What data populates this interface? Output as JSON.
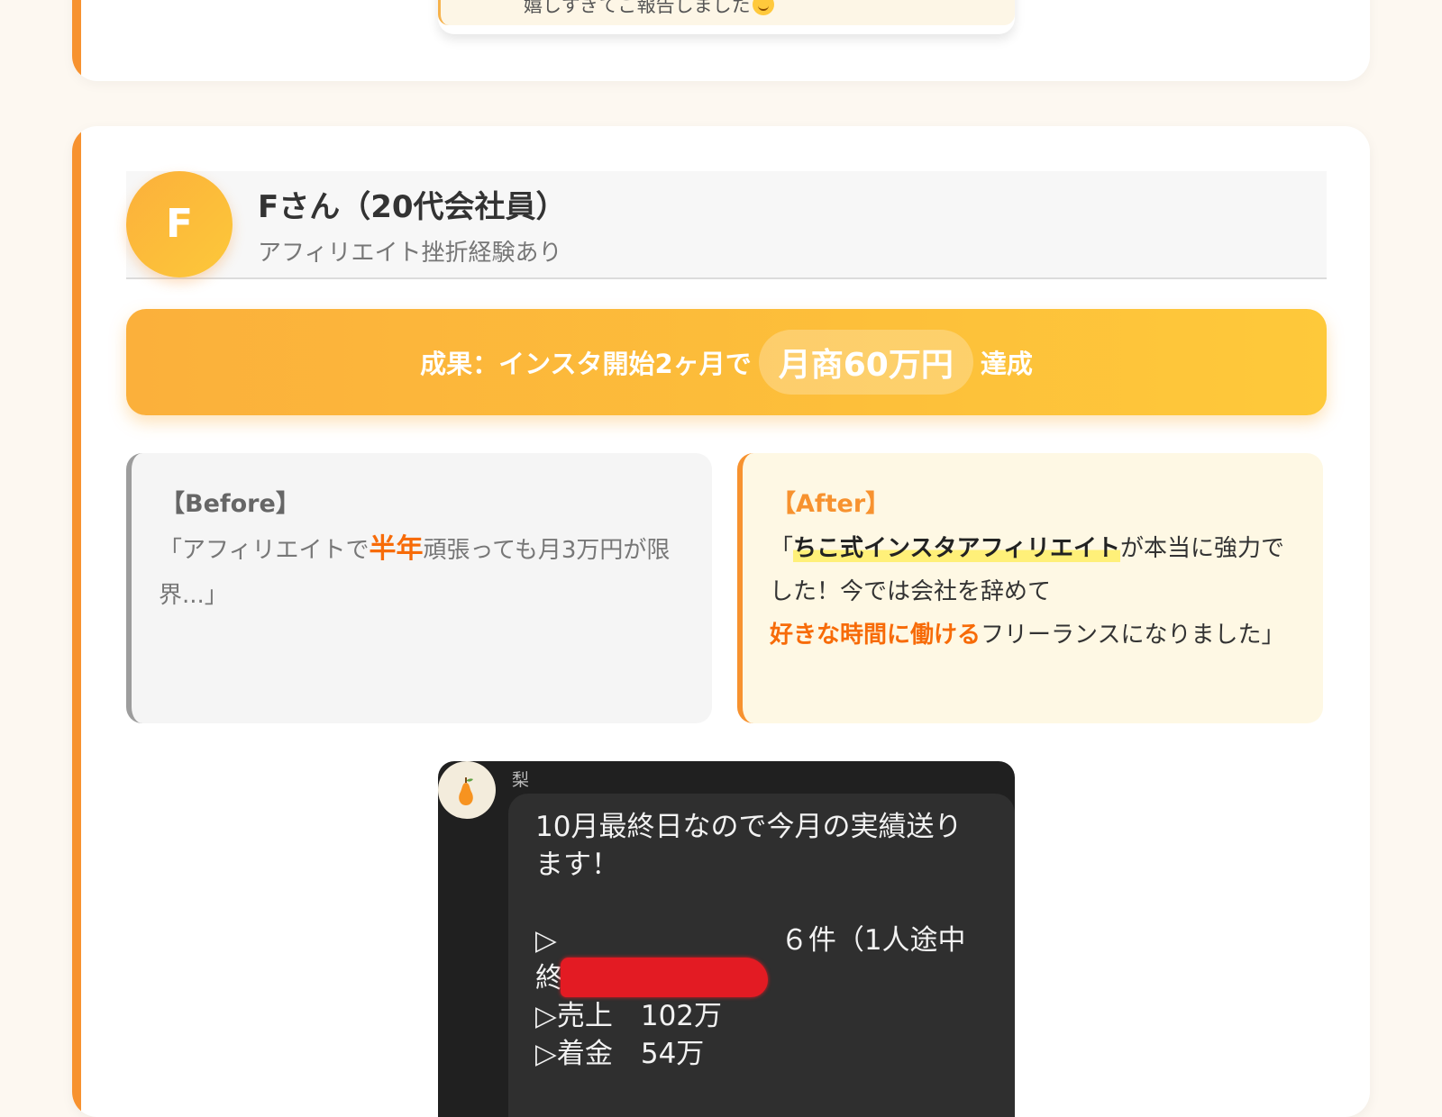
{
  "previous_card": {
    "chat_text": "嬉しすぎてご報告しました"
  },
  "testimonial": {
    "avatar_letter": "F",
    "name": "Fさん（20代会社員）",
    "description": "アフィリエイト挫折経験あり",
    "result": {
      "prefix": "成果：インスタ開始2ヶ月で",
      "highlight": "月商60万円",
      "suffix": "達成"
    },
    "before": {
      "heading": "【Before】",
      "text_1": "「アフィリエイトで",
      "emphasis": "半年",
      "text_2": "頑張っても月3万円が限界...」"
    },
    "after": {
      "heading": "【After】",
      "quote_open": "「",
      "highlight": "ちこ式インスタアフィリエイト",
      "text_1": "が本当に強力でした！今では会社を辞めて",
      "emphasis": "好きな時間に働ける",
      "text_2": "フリーランスになりました」"
    }
  },
  "chat_screenshot": {
    "sender": "梨",
    "avatar_icon": "pear-icon",
    "message": "10月最終日なので今月の実績送ります！\n\n▷　　　　　　　　６件（1人途中終了）\n▷売上　102万\n▷着金　54万"
  },
  "colors": {
    "accent": "#f7922f",
    "banner_start": "#fbb03b",
    "banner_end": "#fec93a",
    "emphasis": "#f76b08",
    "highlight_marker": "#fff079"
  }
}
